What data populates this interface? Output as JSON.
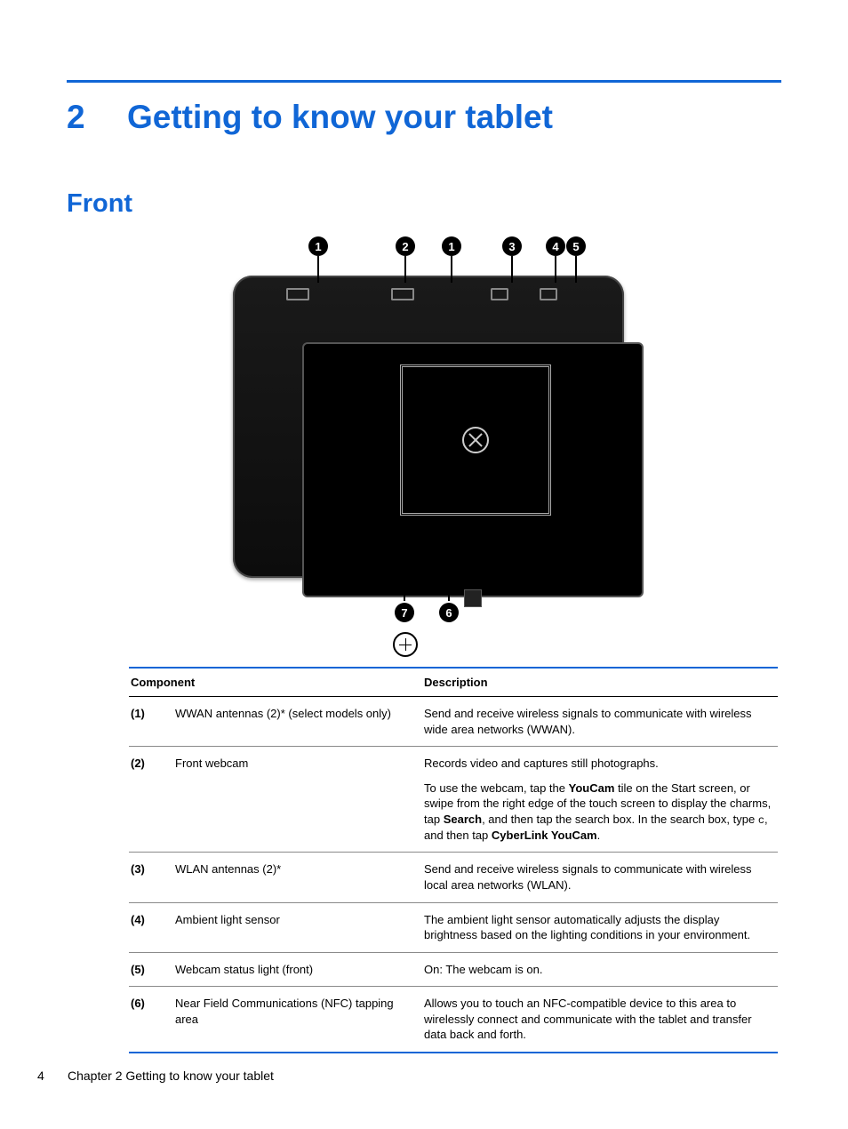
{
  "chapter": {
    "number": "2",
    "title": "Getting to know your tablet"
  },
  "section": {
    "title": "Front"
  },
  "callouts": [
    "1",
    "2",
    "3",
    "4",
    "5",
    "6",
    "7"
  ],
  "table": {
    "headers": {
      "component": "Component",
      "description": "Description"
    },
    "rows": [
      {
        "num": "(1)",
        "component": "WWAN antennas (2)* (select models only)",
        "descParas": [
          {
            "segs": [
              {
                "t": "Send and receive wireless signals to communicate with wireless wide area networks (WWAN)."
              }
            ]
          }
        ]
      },
      {
        "num": "(2)",
        "component": "Front webcam",
        "descParas": [
          {
            "segs": [
              {
                "t": "Records video and captures still photographs."
              }
            ]
          },
          {
            "segs": [
              {
                "t": "To use the webcam, tap the "
              },
              {
                "t": "YouCam",
                "b": true
              },
              {
                "t": " tile on the Start screen, or swipe from the right edge of the touch screen to display the charms, tap "
              },
              {
                "t": "Search",
                "b": true
              },
              {
                "t": ", and then tap the search box. In the search box, type "
              },
              {
                "t": "c",
                "mono": true
              },
              {
                "t": ", and then tap "
              },
              {
                "t": "CyberLink YouCam",
                "b": true
              },
              {
                "t": "."
              }
            ]
          }
        ]
      },
      {
        "num": "(3)",
        "component": "WLAN antennas (2)*",
        "descParas": [
          {
            "segs": [
              {
                "t": "Send and receive wireless signals to communicate with wireless local area networks (WLAN)."
              }
            ]
          }
        ]
      },
      {
        "num": "(4)",
        "component": "Ambient light sensor",
        "descParas": [
          {
            "segs": [
              {
                "t": "The ambient light sensor automatically adjusts the display brightness based on the lighting conditions in your environment."
              }
            ]
          }
        ]
      },
      {
        "num": "(5)",
        "component": "Webcam status light (front)",
        "descParas": [
          {
            "segs": [
              {
                "t": "On: The webcam is on."
              }
            ]
          }
        ]
      },
      {
        "num": "(6)",
        "component": "Near Field Communications (NFC) tapping area",
        "descParas": [
          {
            "segs": [
              {
                "t": "Allows you to touch an NFC-compatible device to this area to wirelessly connect and communicate with the tablet and transfer data back and forth."
              }
            ]
          }
        ]
      }
    ]
  },
  "footer": {
    "page": "4",
    "text": "Chapter 2   Getting to know your tablet"
  }
}
